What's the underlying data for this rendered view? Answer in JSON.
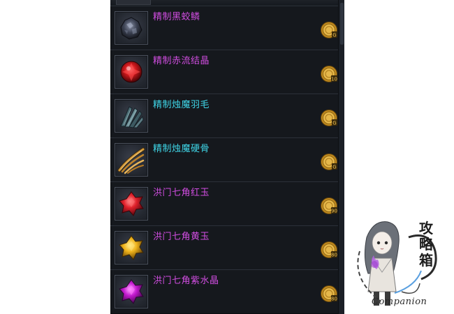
{
  "items": [
    {
      "name": "精制黑蛟鳞",
      "color": "#d04de0",
      "icon": "black-scale-icon",
      "badge": "G"
    },
    {
      "name": "精制赤流结晶",
      "color": "#d04de0",
      "icon": "red-crystal-icon",
      "badge": "10"
    },
    {
      "name": "精制烛魔羽毛",
      "color": "#3fd6e8",
      "icon": "dark-feather-icon",
      "badge": "G"
    },
    {
      "name": "精制烛魔硬骨",
      "color": "#3fd6e8",
      "icon": "golden-bone-icon",
      "badge": "G"
    },
    {
      "name": "洪门七角红玉",
      "color": "#d04de0",
      "icon": "red-gem-icon",
      "badge": "90"
    },
    {
      "name": "洪门七角黄玉",
      "color": "#d04de0",
      "icon": "yellow-gem-icon",
      "badge": "80"
    },
    {
      "name": "洪门七角紫水晶",
      "color": "#d04de0",
      "icon": "purple-gem-icon",
      "badge": "80"
    }
  ],
  "watermark": {
    "cjk": "攻略箱",
    "word": "Companion"
  },
  "colors": {
    "panel_bg": "#15181d",
    "purple_text": "#d04de0",
    "cyan_text": "#3fd6e8",
    "coin_gold": "#d7a531"
  }
}
